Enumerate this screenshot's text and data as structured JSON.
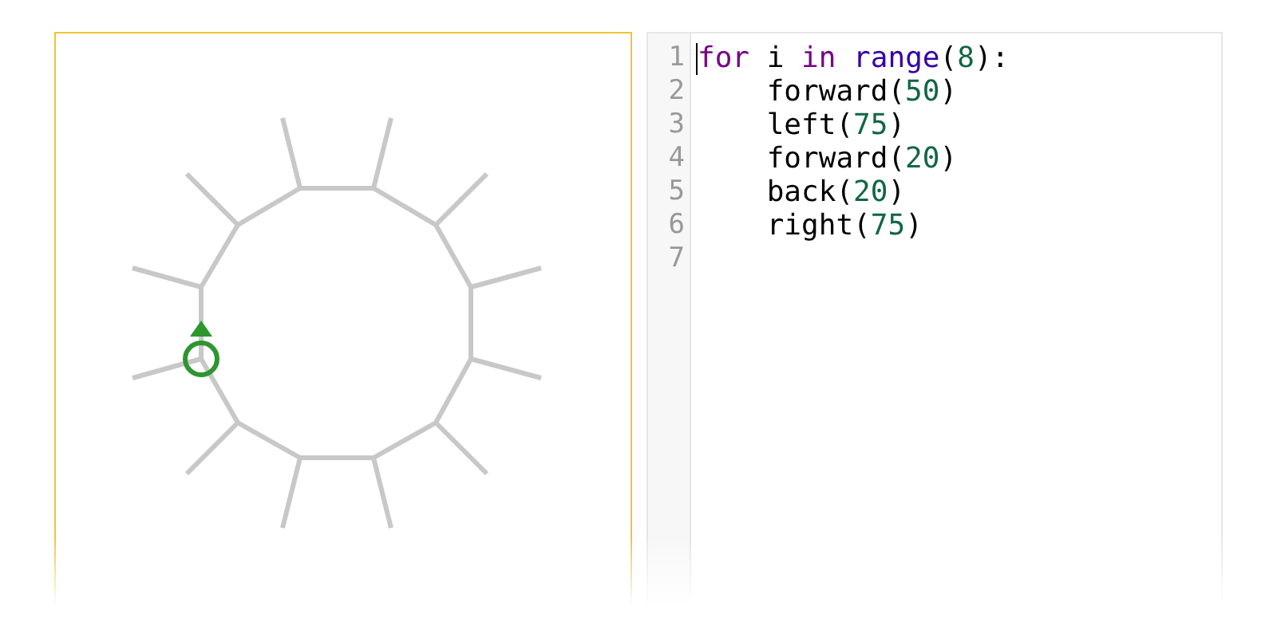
{
  "editor": {
    "lines": [
      {
        "number": "1",
        "cursor": true,
        "tokens": [
          {
            "kind": "keyword",
            "text": "for"
          },
          {
            "kind": "plain",
            "text": " i "
          },
          {
            "kind": "keyword",
            "text": "in"
          },
          {
            "kind": "builtin",
            "text": " range"
          },
          {
            "kind": "plain",
            "text": "("
          },
          {
            "kind": "number",
            "text": "8"
          },
          {
            "kind": "plain",
            "text": "):"
          }
        ]
      },
      {
        "number": "2",
        "tokens": [
          {
            "kind": "plain",
            "text": "    forward("
          },
          {
            "kind": "number",
            "text": "50"
          },
          {
            "kind": "plain",
            "text": ")"
          }
        ]
      },
      {
        "number": "3",
        "tokens": [
          {
            "kind": "plain",
            "text": "    left("
          },
          {
            "kind": "number",
            "text": "75"
          },
          {
            "kind": "plain",
            "text": ")"
          }
        ]
      },
      {
        "number": "4",
        "tokens": [
          {
            "kind": "plain",
            "text": "    forward("
          },
          {
            "kind": "number",
            "text": "20"
          },
          {
            "kind": "plain",
            "text": ")"
          }
        ]
      },
      {
        "number": "5",
        "tokens": [
          {
            "kind": "plain",
            "text": "    back("
          },
          {
            "kind": "number",
            "text": "20"
          },
          {
            "kind": "plain",
            "text": ")"
          }
        ]
      },
      {
        "number": "6",
        "tokens": [
          {
            "kind": "plain",
            "text": "    right("
          },
          {
            "kind": "number",
            "text": "75"
          },
          {
            "kind": "plain",
            "text": ")"
          }
        ]
      },
      {
        "number": "7"
      }
    ]
  }
}
